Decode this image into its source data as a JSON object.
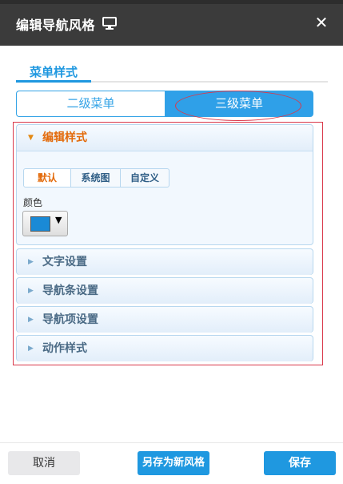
{
  "dialog": {
    "title": "编辑导航风格",
    "monitor_icon": "monitor-icon",
    "close_symbol": "✕"
  },
  "section_tab": {
    "label": "菜单样式"
  },
  "menu_level": {
    "options": [
      "二级菜单",
      "三级菜单"
    ],
    "selected": "三级菜单"
  },
  "panels": [
    {
      "title": "编辑样式",
      "expanded": true,
      "subtabs": [
        "默认",
        "系统图",
        "自定义"
      ],
      "active_subtab": "默认",
      "color_label": "颜色",
      "color_value": "#1a8ad6"
    },
    {
      "title": "文字设置",
      "expanded": false
    },
    {
      "title": "导航条设置",
      "expanded": false
    },
    {
      "title": "导航项设置",
      "expanded": false
    },
    {
      "title": "动作样式",
      "expanded": false
    }
  ],
  "footer": {
    "cancel": "取消",
    "save_as_new": "另存为新风格",
    "save": "保存"
  },
  "colors": {
    "accent": "#1f98e0",
    "header": "#3b3b3b",
    "active_orange": "#e36a0a",
    "highlight_red": "#d9394b"
  }
}
